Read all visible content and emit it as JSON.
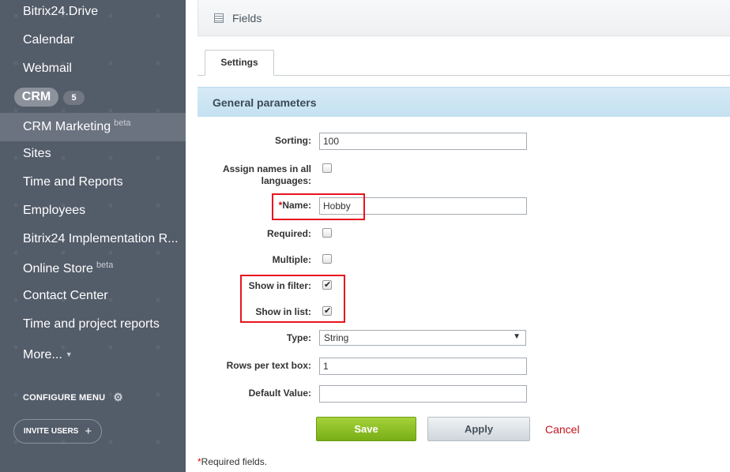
{
  "sidebar": {
    "items": [
      {
        "label": "Bitrix24.Drive"
      },
      {
        "label": "Calendar"
      },
      {
        "label": "Webmail"
      },
      {
        "label": "CRM",
        "badge": "5"
      },
      {
        "label": "CRM Marketing",
        "sup": "beta"
      },
      {
        "label": "Sites"
      },
      {
        "label": "Time and Reports"
      },
      {
        "label": "Employees"
      },
      {
        "label": "Bitrix24 Implementation R..."
      },
      {
        "label": "Online Store",
        "sup": "beta"
      },
      {
        "label": "Contact Center"
      },
      {
        "label": "Time and project reports"
      },
      {
        "label": "More..."
      }
    ],
    "configure_menu": "CONFIGURE MENU",
    "invite_users": "INVITE USERS"
  },
  "header": {
    "title": "Fields"
  },
  "tabs": [
    {
      "label": "Settings"
    }
  ],
  "section": {
    "title": "General parameters"
  },
  "form": {
    "sorting": {
      "label": "Sorting:",
      "value": "100"
    },
    "assign_names": {
      "label_line1": "Assign names in all",
      "label_line2": "languages:",
      "checked": false
    },
    "name": {
      "required_mark": "*",
      "label": "Name:",
      "value": "Hobby"
    },
    "required": {
      "label": "Required:",
      "checked": false
    },
    "multiple": {
      "label": "Multiple:",
      "checked": false
    },
    "show_in_filter": {
      "label": "Show in filter:",
      "checked": true
    },
    "show_in_list": {
      "label": "Show in list:",
      "checked": true
    },
    "type": {
      "label": "Type:",
      "value": "String"
    },
    "rows_per_text_box": {
      "label": "Rows per text box:",
      "value": "1"
    },
    "default_value": {
      "label": "Default Value:",
      "value": ""
    }
  },
  "buttons": {
    "save": "Save",
    "apply": "Apply",
    "cancel": "Cancel"
  },
  "footnote": {
    "mark": "*",
    "text": "Required fields."
  },
  "colors": {
    "sidebar_bg": "#535c69",
    "save_green": "#8cc125",
    "cancel_red": "#c4121b",
    "highlight_red": "#e8141e"
  }
}
